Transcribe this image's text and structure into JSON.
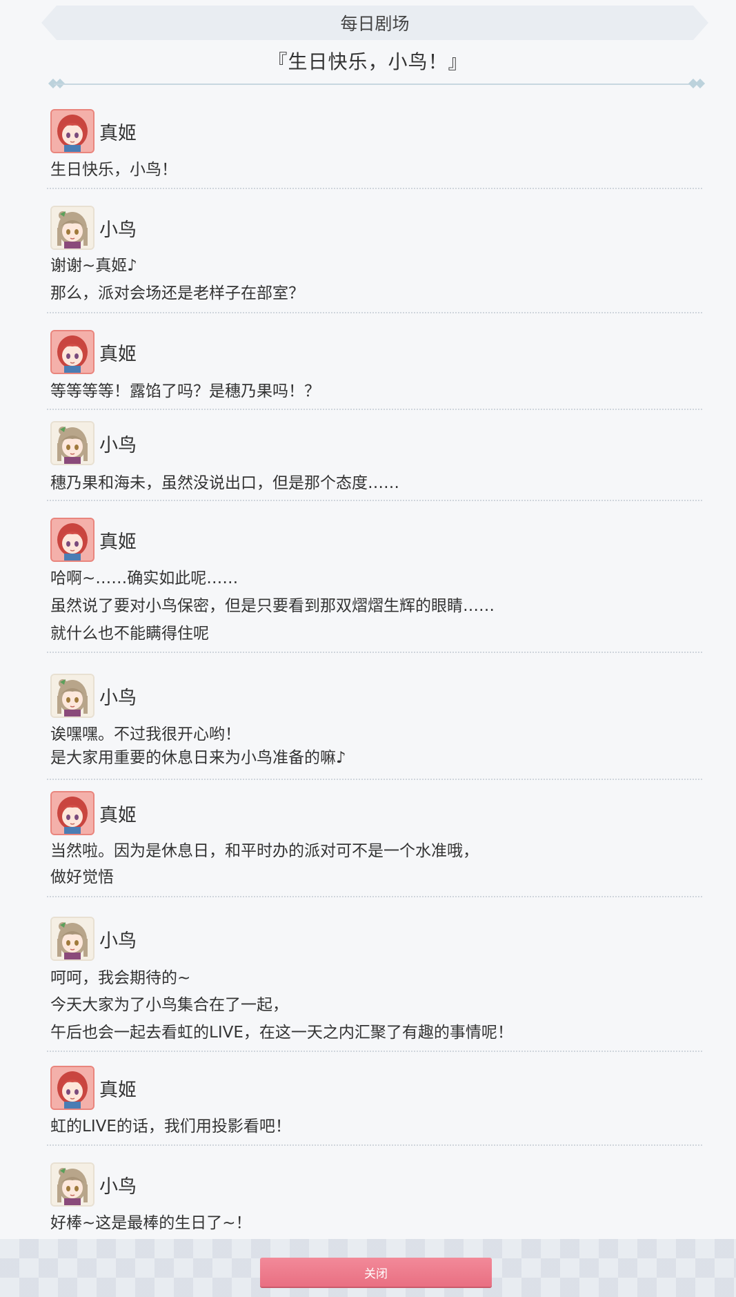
{
  "header": {
    "bar_title": "每日剧场",
    "drama_title": "『生日快乐，小鸟！』"
  },
  "dialogues": [
    {
      "speaker": "真姬",
      "avatar": "maki-avatar",
      "lines": [
        "生日快乐，小鸟！"
      ]
    },
    {
      "speaker": "小鸟",
      "avatar": "kotori-avatar",
      "lines": [
        "谢谢~真姬♪",
        "那么，派对会场还是老样子在部室？"
      ]
    },
    {
      "speaker": "真姬",
      "avatar": "maki-avatar",
      "lines": [
        "等等等等！露馅了吗？是穗乃果吗！？"
      ]
    },
    {
      "speaker": "小鸟",
      "avatar": "kotori-avatar",
      "lines": [
        "穗乃果和海未，虽然没说出口，但是那个态度……"
      ]
    },
    {
      "speaker": "真姬",
      "avatar": "maki-avatar",
      "lines": [
        "哈啊~……确实如此呢……",
        "虽然说了要对小鸟保密，但是只要看到那双熠熠生辉的眼睛……",
        "就什么也不能瞒得住呢"
      ]
    },
    {
      "speaker": "小鸟",
      "avatar": "kotori-avatar",
      "lines": [
        "诶嘿嘿。不过我很开心哟！",
        "是大家用重要的休息日来为小鸟准备的嘛♪"
      ]
    },
    {
      "speaker": "真姬",
      "avatar": "maki-avatar",
      "lines": [
        "当然啦。因为是休息日，和平时办的派对可不是一个水准哦，",
        "做好觉悟"
      ]
    },
    {
      "speaker": "小鸟",
      "avatar": "kotori-avatar",
      "lines": [
        "呵呵，我会期待的~",
        "今天大家为了小鸟集合在了一起，",
        "午后也会一起去看虹的LIVE，在这一天之内汇聚了有趣的事情呢！"
      ]
    },
    {
      "speaker": "真姬",
      "avatar": "maki-avatar",
      "lines": [
        "虹的LIVE的话，我们用投影看吧！"
      ]
    },
    {
      "speaker": "小鸟",
      "avatar": "kotori-avatar",
      "lines": [
        "好棒~这是最棒的生日了~！"
      ]
    }
  ],
  "footer": {
    "close_label": "关闭"
  }
}
